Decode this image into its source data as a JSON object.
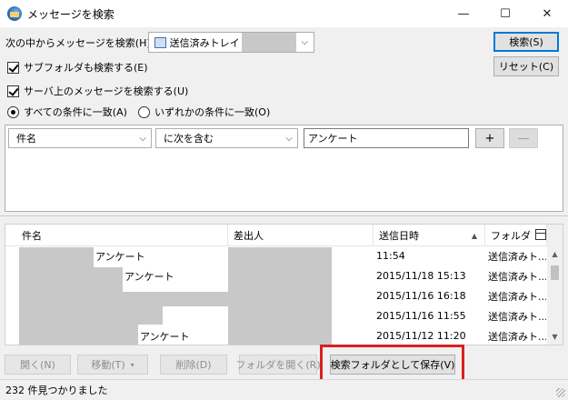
{
  "window": {
    "title": "メッセージを検索",
    "minimize": "—",
    "maximize": "☐",
    "close": "✕"
  },
  "search_in": {
    "label": "次の中からメッセージを検索(H):",
    "folder": "送信済みトレイ"
  },
  "buttons": {
    "search": "検索(S)",
    "reset": "リセット(C)",
    "open": "開く(N)",
    "move": "移動(T)",
    "delete": "削除(D)",
    "open_folder": "フォルダを開く(R)",
    "save_as_folder": "検索フォルダとして保存(V)"
  },
  "options": {
    "subfolders": "サブフォルダも検索する(E)",
    "server": "サーバ上のメッセージを検索する(U)",
    "match_all": "すべての条件に一致(A)",
    "match_any": "いずれかの条件に一致(O)"
  },
  "rule": {
    "field": "件名",
    "operator": "に次を含む",
    "value": "アンケート",
    "add": "+",
    "remove": "—"
  },
  "columns": {
    "subject": "件名",
    "sender": "差出人",
    "date": "送信日時",
    "folder": "フォルダ"
  },
  "rows": [
    {
      "subject": "アンケート",
      "date": "11:54",
      "folder": "送信済みト..."
    },
    {
      "subject": "アンケート",
      "date": "2015/11/18 15:13",
      "folder": "送信済みト..."
    },
    {
      "subject": "",
      "date": "2015/11/16 16:18",
      "folder": "送信済みト..."
    },
    {
      "subject": "",
      "date": "2015/11/16 11:55",
      "folder": "送信済みト..."
    },
    {
      "subject": "アンケート",
      "date": "2015/11/12 11:20",
      "folder": "送信済みト..."
    }
  ],
  "status": {
    "found": "232 件見つかりました"
  },
  "colors": {
    "highlight": "#d9201e",
    "redaction": "#c8c8c8",
    "primary_border": "#0078d7"
  }
}
